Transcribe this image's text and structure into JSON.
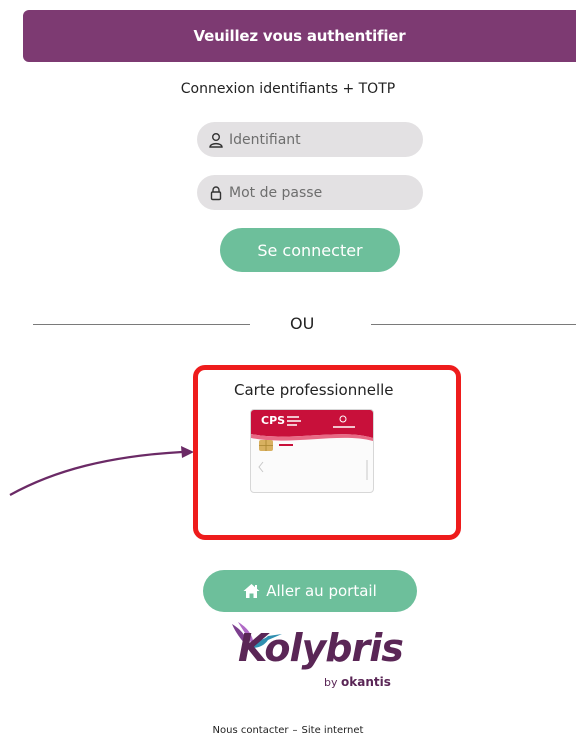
{
  "header": {
    "title": "Veuillez vous authentifier"
  },
  "login": {
    "subtitle": "Connexion identifiants + TOTP",
    "username_placeholder": "Identifiant",
    "password_placeholder": "Mot de passe",
    "submit_label": "Se connecter"
  },
  "separator": {
    "text": "OU"
  },
  "card_login": {
    "label": "Carte professionnelle",
    "card_text": "CPS"
  },
  "portal": {
    "button_label": "Aller au portail",
    "icon": "home-icon"
  },
  "logo": {
    "brand": "Kolybris",
    "by": "by",
    "company": "okantis"
  },
  "footer": {
    "contact": "Nous contacter",
    "dash": "–",
    "website": "Site internet"
  },
  "colors": {
    "header": "#7d3a72",
    "button": "#6dbf9b",
    "field": "#e3e1e3",
    "highlight": "#ee1c1c",
    "arrow": "#6b2a66"
  }
}
